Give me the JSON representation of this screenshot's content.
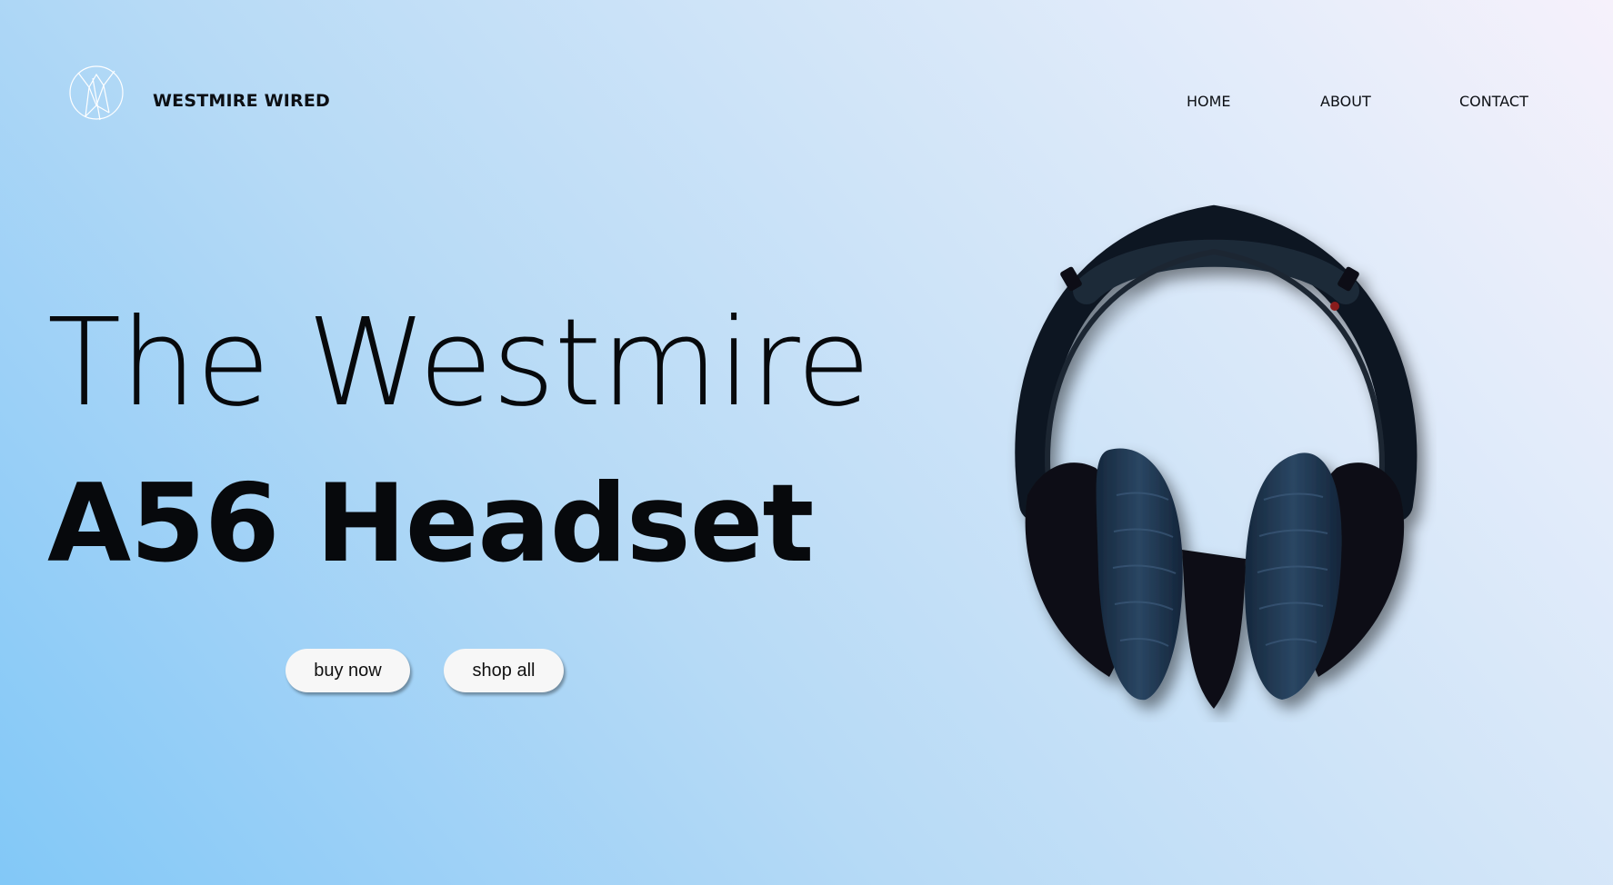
{
  "header": {
    "logo_icon": "westmire-shield-logo-icon",
    "brand": "WESTMIRE WIRED",
    "nav": [
      {
        "label": "HOME"
      },
      {
        "label": "ABOUT"
      },
      {
        "label": "CONTACT"
      }
    ]
  },
  "hero": {
    "line1": "The Westmire",
    "line2": "A56 Headset",
    "buttons": {
      "buy": "buy now",
      "shop": "shop all"
    },
    "image_icon": "headphones-product-image"
  },
  "colors": {
    "gradient_top_right": "#f6f1fb",
    "gradient_bottom_left": "#82c8f7",
    "text": "#07090c",
    "button_bg": "#f7f7f7",
    "headphone_dark": "#0f1722",
    "earpad_navy": "#1f3550"
  }
}
